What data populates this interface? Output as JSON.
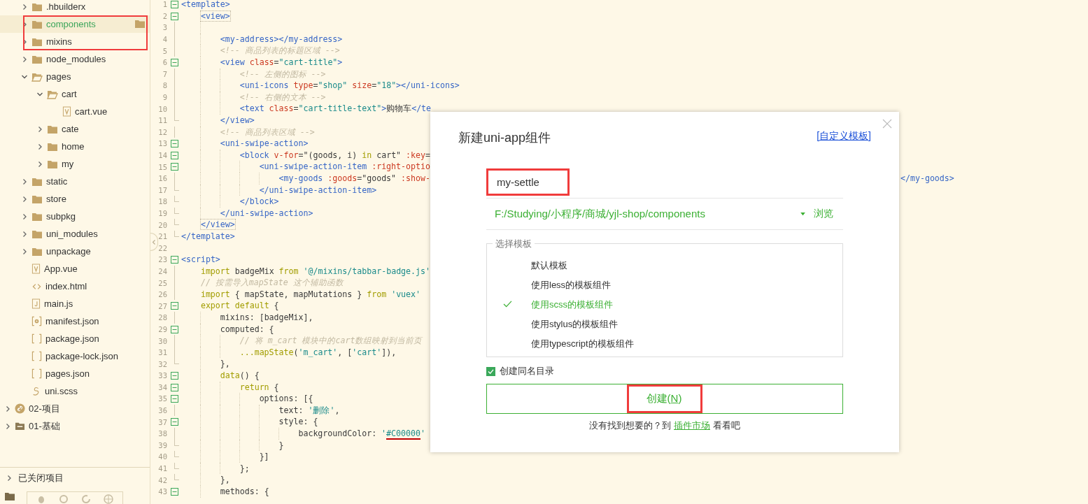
{
  "sidebar": {
    "project_files": [
      {
        "label": ".hbuilderx",
        "kind": "folder",
        "expanded": false,
        "selected": false,
        "marked": false
      },
      {
        "label": "components",
        "kind": "folder",
        "expanded": false,
        "selected": true,
        "marked": true
      },
      {
        "label": "mixins",
        "kind": "folder",
        "expanded": false,
        "selected": false,
        "marked": true
      },
      {
        "label": "node_modules",
        "kind": "folder",
        "expanded": false,
        "selected": false,
        "marked": false
      },
      {
        "label": "pages",
        "kind": "folder",
        "expanded": true,
        "selected": false,
        "marked": false,
        "children": [
          {
            "label": "cart",
            "kind": "folder",
            "expanded": true,
            "selected": false,
            "marked": false,
            "children": [
              {
                "label": "cart.vue",
                "kind": "vue",
                "selected": false,
                "marked": false
              }
            ]
          },
          {
            "label": "cate",
            "kind": "folder",
            "expanded": false,
            "selected": false,
            "marked": false
          },
          {
            "label": "home",
            "kind": "folder",
            "expanded": false,
            "selected": false,
            "marked": false
          },
          {
            "label": "my",
            "kind": "folder",
            "expanded": false,
            "selected": false,
            "marked": false
          }
        ]
      },
      {
        "label": "static",
        "kind": "folder",
        "expanded": false,
        "selected": false,
        "marked": false
      },
      {
        "label": "store",
        "kind": "folder",
        "expanded": false,
        "selected": false,
        "marked": false
      },
      {
        "label": "subpkg",
        "kind": "folder",
        "expanded": false,
        "selected": false,
        "marked": false
      },
      {
        "label": "uni_modules",
        "kind": "folder",
        "expanded": false,
        "selected": false,
        "marked": false
      },
      {
        "label": "unpackage",
        "kind": "folder",
        "expanded": false,
        "selected": false,
        "marked": false
      },
      {
        "label": "App.vue",
        "kind": "vue",
        "selected": false,
        "marked": false
      },
      {
        "label": "index.html",
        "kind": "html",
        "selected": false,
        "marked": false
      },
      {
        "label": "main.js",
        "kind": "js",
        "selected": false,
        "marked": false
      },
      {
        "label": "manifest.json",
        "kind": "manifest",
        "selected": false,
        "marked": false
      },
      {
        "label": "package.json",
        "kind": "json",
        "selected": false,
        "marked": false
      },
      {
        "label": "package-lock.json",
        "kind": "json",
        "selected": false,
        "marked": false
      },
      {
        "label": "pages.json",
        "kind": "json",
        "selected": false,
        "marked": false
      },
      {
        "label": "uni.scss",
        "kind": "scss",
        "selected": false,
        "marked": false
      }
    ],
    "projects": [
      {
        "label": "02-项目",
        "kind": "link-project",
        "expanded": false,
        "selected": false,
        "marked": false
      },
      {
        "label": "01-基础",
        "kind": "project",
        "expanded": false,
        "selected": false,
        "marked": false
      }
    ],
    "closed_projects": {
      "label": "已关闭项目",
      "expanded": false
    }
  },
  "editor": {
    "lines": [
      {
        "number": "1",
        "kind": "fold-start",
        "tokens": [
          {
            "kind": "tag",
            "text": "<template>"
          }
        ]
      },
      {
        "number": "2",
        "kind": "fold-start",
        "tokens": [
          {
            "kind": "tag-match",
            "text": "<view>"
          }
        ]
      },
      {
        "number": "3",
        "kind": "fold-body"
      },
      {
        "number": "4",
        "kind": "fold-body",
        "tokens": [
          {
            "kind": "tag",
            "text": "<my-address></my-address>"
          }
        ]
      },
      {
        "number": "5",
        "kind": "fold-body",
        "tokens": [
          {
            "kind": "comment",
            "text": "<!-- 商品列表的标题区域 -->"
          }
        ]
      },
      {
        "number": "6",
        "kind": "fold-start",
        "tokens": [
          {
            "kind": "tag",
            "text": "<view "
          },
          {
            "kind": "attr",
            "text": "class"
          },
          {
            "kind": "plain",
            "text": "="
          },
          {
            "kind": "string",
            "text": "\"cart-title\""
          },
          {
            "kind": "tag",
            "text": ">"
          }
        ]
      },
      {
        "number": "7",
        "kind": "fold-body",
        "tokens": [
          {
            "kind": "comment",
            "text": "<!-- 左侧的图标 -->"
          }
        ]
      },
      {
        "number": "8",
        "kind": "fold-body",
        "tokens": [
          {
            "kind": "tag",
            "text": "<uni-icons "
          },
          {
            "kind": "attr",
            "text": "type"
          },
          {
            "kind": "plain",
            "text": "="
          },
          {
            "kind": "string",
            "text": "\"shop\" "
          },
          {
            "kind": "attr",
            "text": "size"
          },
          {
            "kind": "plain",
            "text": "="
          },
          {
            "kind": "string",
            "text": "\"18\""
          },
          {
            "kind": "tag",
            "text": "></uni-icons>"
          }
        ]
      },
      {
        "number": "9",
        "kind": "fold-body",
        "tokens": [
          {
            "kind": "comment",
            "text": "<!-- 右侧的文本 -->"
          }
        ]
      },
      {
        "number": "10",
        "kind": "fold-body",
        "tokens": [
          {
            "kind": "tag",
            "text": "<text "
          },
          {
            "kind": "attr",
            "text": "class"
          },
          {
            "kind": "plain",
            "text": "="
          },
          {
            "kind": "string",
            "text": "\"cart-title-text\""
          },
          {
            "kind": "tag",
            "text": ">"
          },
          {
            "kind": "plain",
            "text": "购物车"
          },
          {
            "kind": "tag",
            "text": "</te"
          }
        ]
      },
      {
        "number": "11",
        "kind": "fold-end",
        "tokens": [
          {
            "kind": "tag",
            "text": "</view>"
          }
        ]
      },
      {
        "number": "12",
        "kind": "fold-body",
        "tokens": [
          {
            "kind": "comment",
            "text": "<!-- 商品列表区域 -->"
          }
        ]
      },
      {
        "number": "13",
        "kind": "fold-start",
        "tokens": [
          {
            "kind": "tag",
            "text": "<uni-swipe-action>"
          }
        ]
      },
      {
        "number": "14",
        "kind": "fold-start",
        "tokens": [
          {
            "kind": "tag",
            "text": "<block "
          },
          {
            "kind": "attr",
            "text": "v-for"
          },
          {
            "kind": "plain",
            "text": "=\"(goods, i) "
          },
          {
            "kind": "keyword",
            "text": "in"
          },
          {
            "kind": "plain",
            "text": " cart\" "
          },
          {
            "kind": "attr",
            "text": ":key"
          },
          {
            "kind": "plain",
            "text": "="
          }
        ]
      },
      {
        "number": "15",
        "kind": "fold-start",
        "tokens": [
          {
            "kind": "tag",
            "text": "<uni-swipe-action-item "
          },
          {
            "kind": "attr",
            "text": ":right-optio"
          }
        ]
      },
      {
        "number": "16",
        "kind": "fold-body",
        "tokens": [
          {
            "kind": "tag",
            "text": "<my-goods "
          },
          {
            "kind": "attr",
            "text": ":goods"
          },
          {
            "kind": "plain",
            "text": "=\"goods\" "
          },
          {
            "kind": "attr",
            "text": ":show-"
          }
        ],
        "tail": [
          {
            "kind": "tag",
            "text": "</my-goods>"
          }
        ]
      },
      {
        "number": "17",
        "kind": "fold-end",
        "tokens": [
          {
            "kind": "tag",
            "text": "</uni-swipe-action-item>"
          }
        ]
      },
      {
        "number": "18",
        "kind": "fold-end",
        "tokens": [
          {
            "kind": "tag",
            "text": "</block>"
          }
        ]
      },
      {
        "number": "19",
        "kind": "fold-end",
        "tokens": [
          {
            "kind": "tag",
            "text": "</uni-swipe-action>"
          }
        ]
      },
      {
        "number": "20",
        "kind": "fold-end",
        "tokens": [
          {
            "kind": "tag-match",
            "text": "</view>"
          }
        ]
      },
      {
        "number": "21",
        "kind": "fold-end",
        "tokens": [
          {
            "kind": "tag",
            "text": "</template>"
          }
        ]
      },
      {
        "number": "22",
        "kind": "blank"
      },
      {
        "number": "23",
        "kind": "fold-start",
        "tokens": [
          {
            "kind": "tag",
            "text": "<script>"
          }
        ]
      },
      {
        "number": "24",
        "kind": "fold-body",
        "tokens": [
          {
            "kind": "keyword",
            "text": "import"
          },
          {
            "kind": "plain",
            "text": " badgeMix "
          },
          {
            "kind": "keyword",
            "text": "from"
          },
          {
            "kind": "string",
            "text": " '@/mixins/tabbar-badge.js'"
          }
        ]
      },
      {
        "number": "25",
        "kind": "fold-body",
        "tokens": [
          {
            "kind": "comment",
            "text": "// 按需导入mapState 这个辅助函数"
          }
        ]
      },
      {
        "number": "26",
        "kind": "fold-body",
        "tokens": [
          {
            "kind": "keyword",
            "text": "import"
          },
          {
            "kind": "plain",
            "text": " { mapState, mapMutations } "
          },
          {
            "kind": "keyword",
            "text": "from"
          },
          {
            "kind": "string",
            "text": " 'vuex'"
          }
        ]
      },
      {
        "number": "27",
        "kind": "fold-start",
        "tokens": [
          {
            "kind": "keyword",
            "text": "export default"
          },
          {
            "kind": "plain",
            "text": " {"
          }
        ]
      },
      {
        "number": "28",
        "kind": "fold-body",
        "tokens": [
          {
            "kind": "plain",
            "text": "mixins: [badgeMix],"
          }
        ]
      },
      {
        "number": "29",
        "kind": "fold-start",
        "tokens": [
          {
            "kind": "plain",
            "text": "computed: {"
          }
        ]
      },
      {
        "number": "30",
        "kind": "fold-body",
        "tokens": [
          {
            "kind": "comment",
            "text": "// 将 m_cart 模块中的cart数组映射到当前页"
          }
        ]
      },
      {
        "number": "31",
        "kind": "fold-body",
        "tokens": [
          {
            "kind": "keyword",
            "text": "...mapState"
          },
          {
            "kind": "plain",
            "text": "("
          },
          {
            "kind": "string",
            "text": "'m_cart'"
          },
          {
            "kind": "plain",
            "text": ", ["
          },
          {
            "kind": "string",
            "text": "'cart'"
          },
          {
            "kind": "plain",
            "text": "]),"
          }
        ]
      },
      {
        "number": "32",
        "kind": "fold-end",
        "tokens": [
          {
            "kind": "plain",
            "text": "},"
          }
        ]
      },
      {
        "number": "33",
        "kind": "fold-start",
        "tokens": [
          {
            "kind": "keyword",
            "text": "data"
          },
          {
            "kind": "plain",
            "text": "() {"
          }
        ]
      },
      {
        "number": "34",
        "kind": "fold-start",
        "tokens": [
          {
            "kind": "keyword",
            "text": "return"
          },
          {
            "kind": "plain",
            "text": " {"
          }
        ]
      },
      {
        "number": "35",
        "kind": "fold-start",
        "tokens": [
          {
            "kind": "plain",
            "text": "options: [{"
          }
        ]
      },
      {
        "number": "36",
        "kind": "fold-body",
        "tokens": [
          {
            "kind": "plain",
            "text": "text: "
          },
          {
            "kind": "string",
            "text": "'删除'"
          },
          {
            "kind": "plain",
            "text": ","
          }
        ]
      },
      {
        "number": "37",
        "kind": "fold-start",
        "tokens": [
          {
            "kind": "plain",
            "text": "style: {"
          }
        ]
      },
      {
        "number": "38",
        "kind": "fold-body",
        "tokens": [
          {
            "kind": "plain",
            "text": "backgroundColor: "
          },
          {
            "kind": "string",
            "text": "'"
          },
          {
            "kind": "string-error",
            "text": "#C00000"
          },
          {
            "kind": "string",
            "text": "'"
          }
        ]
      },
      {
        "number": "39",
        "kind": "fold-end",
        "tokens": [
          {
            "kind": "plain",
            "text": "}"
          }
        ]
      },
      {
        "number": "40",
        "kind": "fold-end",
        "tokens": [
          {
            "kind": "plain",
            "text": "}]"
          }
        ]
      },
      {
        "number": "41",
        "kind": "fold-end",
        "tokens": [
          {
            "kind": "plain",
            "text": "};"
          }
        ]
      },
      {
        "number": "42",
        "kind": "fold-end",
        "tokens": [
          {
            "kind": "plain",
            "text": "},"
          }
        ]
      },
      {
        "number": "43",
        "kind": "fold-start",
        "tokens": [
          {
            "kind": "plain",
            "text": "methods: {"
          }
        ]
      }
    ]
  },
  "dialog": {
    "title": "新建uni-app组件",
    "custom_template_link": "[自定义模板]",
    "name_field": {
      "value": "my-settle",
      "marked": true
    },
    "path_field": {
      "value": "F:/Studying/小程序/商城/yjl-shop/components",
      "browse_button": "浏览"
    },
    "template_group": {
      "legend": "选择模板",
      "options": [
        {
          "label": "默认模板",
          "selected": false
        },
        {
          "label": "使用less的模板组件",
          "selected": false
        },
        {
          "label": "使用scss的模板组件",
          "selected": true
        },
        {
          "label": "使用stylus的模板组件",
          "selected": false
        },
        {
          "label": "使用typescript的模板组件",
          "selected": false
        }
      ]
    },
    "same_name_dir": {
      "label": "创建同名目录",
      "checked": true
    },
    "create_button": {
      "label_before": "创建(",
      "mnemonic": "N",
      "label_after": ")",
      "marked": true
    },
    "footer": {
      "before": "没有找到想要的？到 ",
      "link": "插件市场",
      "after": " 看看吧"
    }
  }
}
